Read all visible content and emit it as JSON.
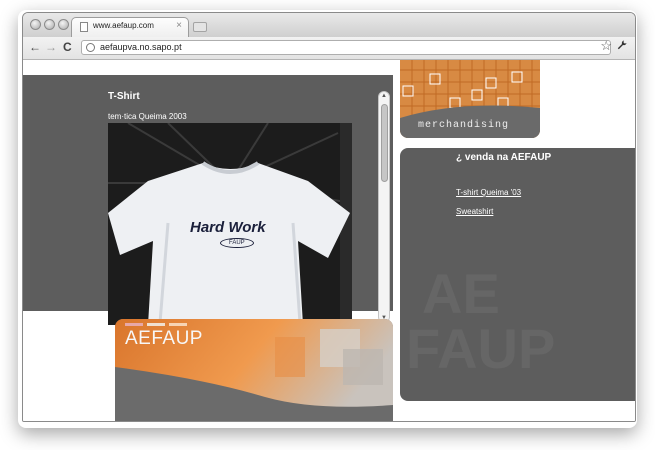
{
  "browser": {
    "tab_title": "www.aefaup.com",
    "tab_close": "×",
    "url": "aefaupva.no.sapo.pt",
    "nav": {
      "back": "←",
      "forward": "→",
      "reload": "C"
    },
    "icons": {
      "star": "☆",
      "wrench": "🔧"
    }
  },
  "left_panel": {
    "title": "T-Shirt",
    "subtitle": "tem·tica Queima 2003",
    "shirt_text_top": "Hard Work",
    "shirt_text_bottom": "FAUP"
  },
  "merch_banner": {
    "label": "merchandising"
  },
  "sale_panel": {
    "title": "¿ venda na AEFAUP",
    "links": [
      "T-shirt Queima '03",
      "Sweatshirt"
    ],
    "watermark_lines": [
      "AE",
      "FAUP"
    ]
  },
  "bottom_banner": {
    "label": "AEFAUP"
  },
  "colors": {
    "panel_gray": "#5d5d5d",
    "accent_orange": "#e0823a"
  }
}
